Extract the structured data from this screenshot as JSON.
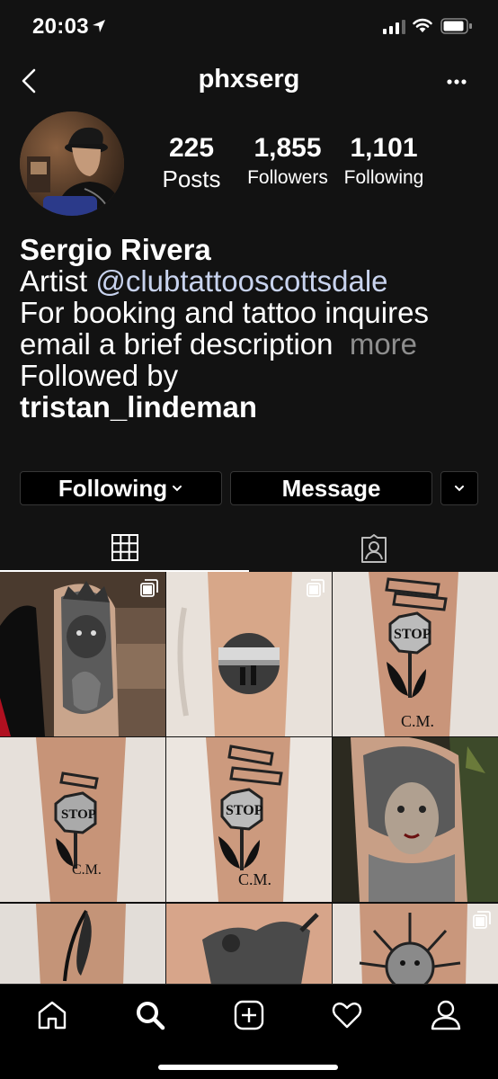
{
  "status_bar": {
    "time": "20:03"
  },
  "nav": {
    "title": "phxserg"
  },
  "profile": {
    "stats": [
      {
        "number": "225",
        "label": "Posts"
      },
      {
        "number": "1,855",
        "label": "Followers"
      },
      {
        "number": "1,101",
        "label": "Following"
      }
    ],
    "name": "Sergio Rivera",
    "bio_prefix": "Artist ",
    "bio_mention": "@clubtattooscottsdale",
    "bio_text": "For booking and tattoo inquires email a brief description",
    "bio_more": "more",
    "followed_by_label": "Followed by",
    "followed_by_user": "tristan_lindeman"
  },
  "actions": {
    "following_label": "Following",
    "message_label": "Message"
  },
  "tabs": [
    {
      "icon": "grid-icon",
      "active": true
    },
    {
      "icon": "tagged-icon",
      "active": false
    }
  ],
  "grid_posts": [
    {
      "subject": "arm-tattoo-crown-lion",
      "multi": true
    },
    {
      "subject": "forearm-circle-landscape",
      "multi": true
    },
    {
      "subject": "forearm-stop-sign",
      "multi": false
    },
    {
      "subject": "forearm-stop-sign",
      "multi": false
    },
    {
      "subject": "forearm-stop-sign",
      "multi": false
    },
    {
      "subject": "medusa-tattoo",
      "multi": false
    },
    {
      "subject": "feather-tattoo",
      "multi": false
    },
    {
      "subject": "figure-tattoo",
      "multi": false
    },
    {
      "subject": "sun-face-tattoo",
      "multi": true
    }
  ],
  "bottom_nav": [
    {
      "icon": "home-icon"
    },
    {
      "icon": "search-icon"
    },
    {
      "icon": "new-post-icon"
    },
    {
      "icon": "activity-heart-icon"
    },
    {
      "icon": "profile-icon"
    }
  ]
}
